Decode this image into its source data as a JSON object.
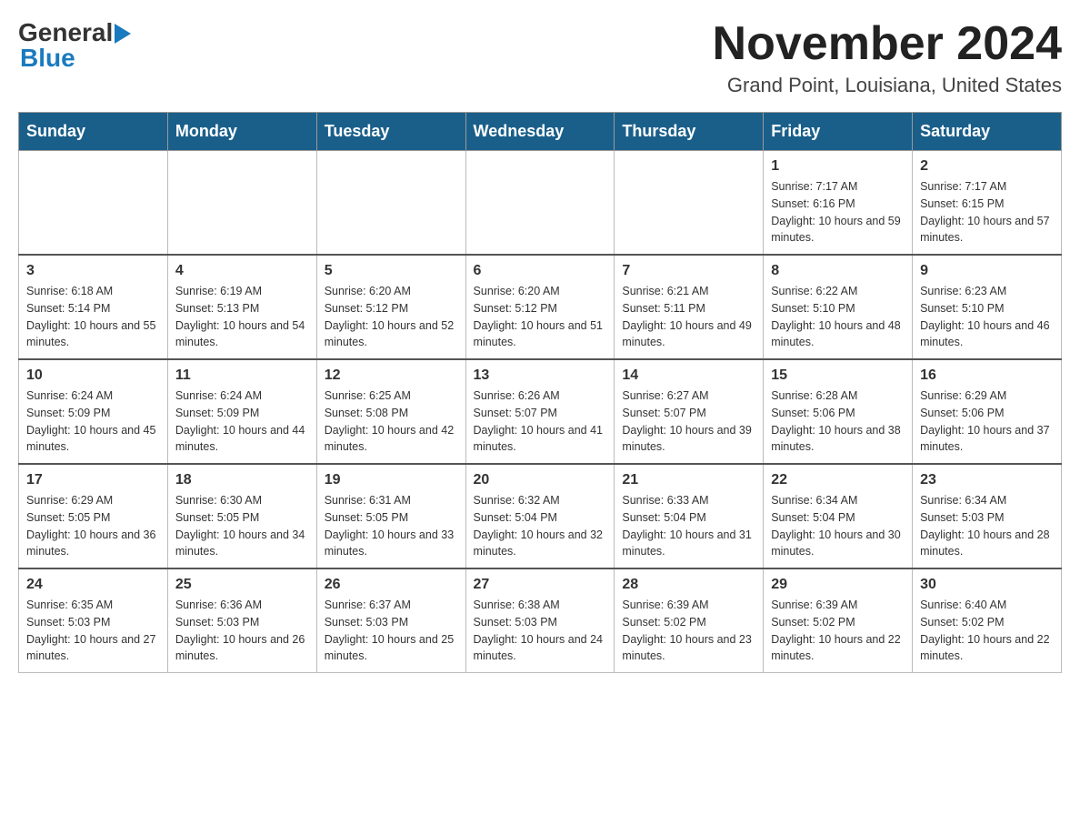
{
  "header": {
    "logo": {
      "general": "General",
      "blue": "Blue",
      "arrow": "▶"
    },
    "title": "November 2024",
    "subtitle": "Grand Point, Louisiana, United States"
  },
  "calendar": {
    "days_of_week": [
      "Sunday",
      "Monday",
      "Tuesday",
      "Wednesday",
      "Thursday",
      "Friday",
      "Saturday"
    ],
    "weeks": [
      {
        "days": [
          {
            "number": "",
            "info": ""
          },
          {
            "number": "",
            "info": ""
          },
          {
            "number": "",
            "info": ""
          },
          {
            "number": "",
            "info": ""
          },
          {
            "number": "",
            "info": ""
          },
          {
            "number": "1",
            "info": "Sunrise: 7:17 AM\nSunset: 6:16 PM\nDaylight: 10 hours and 59 minutes."
          },
          {
            "number": "2",
            "info": "Sunrise: 7:17 AM\nSunset: 6:15 PM\nDaylight: 10 hours and 57 minutes."
          }
        ]
      },
      {
        "days": [
          {
            "number": "3",
            "info": "Sunrise: 6:18 AM\nSunset: 5:14 PM\nDaylight: 10 hours and 55 minutes."
          },
          {
            "number": "4",
            "info": "Sunrise: 6:19 AM\nSunset: 5:13 PM\nDaylight: 10 hours and 54 minutes."
          },
          {
            "number": "5",
            "info": "Sunrise: 6:20 AM\nSunset: 5:12 PM\nDaylight: 10 hours and 52 minutes."
          },
          {
            "number": "6",
            "info": "Sunrise: 6:20 AM\nSunset: 5:12 PM\nDaylight: 10 hours and 51 minutes."
          },
          {
            "number": "7",
            "info": "Sunrise: 6:21 AM\nSunset: 5:11 PM\nDaylight: 10 hours and 49 minutes."
          },
          {
            "number": "8",
            "info": "Sunrise: 6:22 AM\nSunset: 5:10 PM\nDaylight: 10 hours and 48 minutes."
          },
          {
            "number": "9",
            "info": "Sunrise: 6:23 AM\nSunset: 5:10 PM\nDaylight: 10 hours and 46 minutes."
          }
        ]
      },
      {
        "days": [
          {
            "number": "10",
            "info": "Sunrise: 6:24 AM\nSunset: 5:09 PM\nDaylight: 10 hours and 45 minutes."
          },
          {
            "number": "11",
            "info": "Sunrise: 6:24 AM\nSunset: 5:09 PM\nDaylight: 10 hours and 44 minutes."
          },
          {
            "number": "12",
            "info": "Sunrise: 6:25 AM\nSunset: 5:08 PM\nDaylight: 10 hours and 42 minutes."
          },
          {
            "number": "13",
            "info": "Sunrise: 6:26 AM\nSunset: 5:07 PM\nDaylight: 10 hours and 41 minutes."
          },
          {
            "number": "14",
            "info": "Sunrise: 6:27 AM\nSunset: 5:07 PM\nDaylight: 10 hours and 39 minutes."
          },
          {
            "number": "15",
            "info": "Sunrise: 6:28 AM\nSunset: 5:06 PM\nDaylight: 10 hours and 38 minutes."
          },
          {
            "number": "16",
            "info": "Sunrise: 6:29 AM\nSunset: 5:06 PM\nDaylight: 10 hours and 37 minutes."
          }
        ]
      },
      {
        "days": [
          {
            "number": "17",
            "info": "Sunrise: 6:29 AM\nSunset: 5:05 PM\nDaylight: 10 hours and 36 minutes."
          },
          {
            "number": "18",
            "info": "Sunrise: 6:30 AM\nSunset: 5:05 PM\nDaylight: 10 hours and 34 minutes."
          },
          {
            "number": "19",
            "info": "Sunrise: 6:31 AM\nSunset: 5:05 PM\nDaylight: 10 hours and 33 minutes."
          },
          {
            "number": "20",
            "info": "Sunrise: 6:32 AM\nSunset: 5:04 PM\nDaylight: 10 hours and 32 minutes."
          },
          {
            "number": "21",
            "info": "Sunrise: 6:33 AM\nSunset: 5:04 PM\nDaylight: 10 hours and 31 minutes."
          },
          {
            "number": "22",
            "info": "Sunrise: 6:34 AM\nSunset: 5:04 PM\nDaylight: 10 hours and 30 minutes."
          },
          {
            "number": "23",
            "info": "Sunrise: 6:34 AM\nSunset: 5:03 PM\nDaylight: 10 hours and 28 minutes."
          }
        ]
      },
      {
        "days": [
          {
            "number": "24",
            "info": "Sunrise: 6:35 AM\nSunset: 5:03 PM\nDaylight: 10 hours and 27 minutes."
          },
          {
            "number": "25",
            "info": "Sunrise: 6:36 AM\nSunset: 5:03 PM\nDaylight: 10 hours and 26 minutes."
          },
          {
            "number": "26",
            "info": "Sunrise: 6:37 AM\nSunset: 5:03 PM\nDaylight: 10 hours and 25 minutes."
          },
          {
            "number": "27",
            "info": "Sunrise: 6:38 AM\nSunset: 5:03 PM\nDaylight: 10 hours and 24 minutes."
          },
          {
            "number": "28",
            "info": "Sunrise: 6:39 AM\nSunset: 5:02 PM\nDaylight: 10 hours and 23 minutes."
          },
          {
            "number": "29",
            "info": "Sunrise: 6:39 AM\nSunset: 5:02 PM\nDaylight: 10 hours and 22 minutes."
          },
          {
            "number": "30",
            "info": "Sunrise: 6:40 AM\nSunset: 5:02 PM\nDaylight: 10 hours and 22 minutes."
          }
        ]
      }
    ]
  }
}
